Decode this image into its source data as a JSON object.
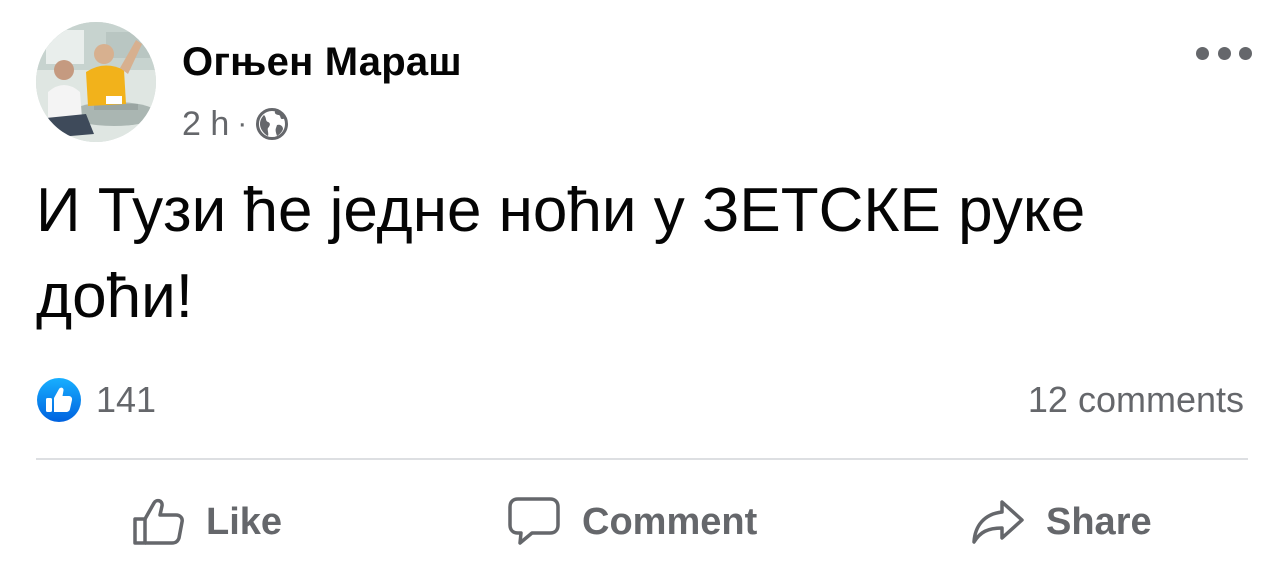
{
  "post": {
    "author": {
      "name": "Огњен Мараш",
      "avatar": "avatar"
    },
    "meta": {
      "time": "2 h",
      "separator": "·",
      "audience_icon": "globe-icon"
    },
    "more_icon": "ellipsis-icon",
    "text": "И Тузи ће једне ноћи у ЗЕТСКЕ руке доћи!",
    "reactions": {
      "icon": "like-reaction-icon",
      "count": "141"
    },
    "comments_label": "12 comments",
    "actions": {
      "like": {
        "icon": "thumbs-up-icon",
        "label": "Like"
      },
      "comment": {
        "icon": "comment-bubble-icon",
        "label": "Comment"
      },
      "share": {
        "icon": "share-arrow-icon",
        "label": "Share"
      }
    },
    "colors": {
      "text": "#050505",
      "secondary": "#65676b",
      "like_blue": "#1877f2",
      "divider": "#dddfe2"
    }
  }
}
